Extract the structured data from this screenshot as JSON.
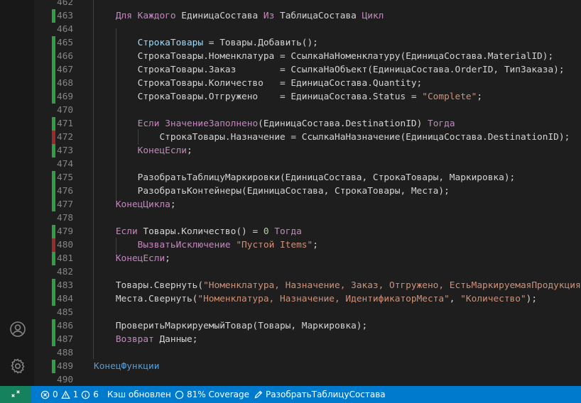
{
  "editor": {
    "lines": [
      {
        "n": "462",
        "g": "",
        "t": []
      },
      {
        "n": "463",
        "g": "add",
        "t": [
          [
            "    ",
            "plain"
          ],
          [
            "Для Каждого",
            "kw"
          ],
          [
            " ЕдиницаСостава ",
            "plain"
          ],
          [
            "Из",
            "kw"
          ],
          [
            " ТаблицаСостава ",
            "plain"
          ],
          [
            "Цикл",
            "kw"
          ]
        ]
      },
      {
        "n": "464",
        "g": "",
        "t": []
      },
      {
        "n": "465",
        "g": "add",
        "t": [
          [
            "        ",
            "plain"
          ],
          [
            "СтрокаТовары",
            "var"
          ],
          [
            " = Товары.Добавить();",
            "plain"
          ]
        ]
      },
      {
        "n": "466",
        "g": "add",
        "t": [
          [
            "        СтрокаТовары.Номенклатура = СсылкаНаНоменклатуру(ЕдиницаСостава.MaterialID);",
            "plain"
          ]
        ]
      },
      {
        "n": "467",
        "g": "add",
        "t": [
          [
            "        СтрокаТовары.Заказ        = СсылкаНаОбъект(ЕдиницаСостава.OrderID, ТипЗаказа);",
            "plain"
          ]
        ]
      },
      {
        "n": "468",
        "g": "add",
        "t": [
          [
            "        СтрокаТовары.Количество   = ЕдиницаСостава.Quantity;",
            "plain"
          ]
        ]
      },
      {
        "n": "469",
        "g": "add",
        "t": [
          [
            "        СтрокаТовары.Отгружено    = ЕдиницаСостава.Status = ",
            "plain"
          ],
          [
            "\"Complete\"",
            "str"
          ],
          [
            ";",
            "plain"
          ]
        ]
      },
      {
        "n": "470",
        "g": "",
        "t": []
      },
      {
        "n": "471",
        "g": "add",
        "t": [
          [
            "        ",
            "plain"
          ],
          [
            "Если",
            "kw"
          ],
          [
            " ",
            "plain"
          ],
          [
            "ЗначениеЗаполнено",
            "fn"
          ],
          [
            "(ЕдиницаСостава.DestinationID) ",
            "plain"
          ],
          [
            "Тогда",
            "kw"
          ]
        ]
      },
      {
        "n": "472",
        "g": "del",
        "t": [
          [
            "            СтрокаТовары.Назначение = СсылкаНаНазначение(ЕдиницаСостава.DestinationID);",
            "plain"
          ]
        ]
      },
      {
        "n": "473",
        "g": "add",
        "t": [
          [
            "        ",
            "plain"
          ],
          [
            "КонецЕсли",
            "kw"
          ],
          [
            ";",
            "plain"
          ]
        ]
      },
      {
        "n": "474",
        "g": "",
        "t": []
      },
      {
        "n": "475",
        "g": "add",
        "t": [
          [
            "        РазобратьТаблицуМаркировки(ЕдиницаСостава, СтрокаТовары, Маркировка);",
            "plain"
          ]
        ]
      },
      {
        "n": "476",
        "g": "add",
        "t": [
          [
            "        РазобратьКонтейнеры(ЕдиницаСостава, СтрокаТовары, Места);",
            "plain"
          ]
        ]
      },
      {
        "n": "477",
        "g": "add",
        "t": [
          [
            "    ",
            "plain"
          ],
          [
            "КонецЦикла",
            "kw"
          ],
          [
            ";",
            "plain"
          ]
        ]
      },
      {
        "n": "478",
        "g": "",
        "t": []
      },
      {
        "n": "479",
        "g": "add",
        "t": [
          [
            "    ",
            "plain"
          ],
          [
            "Если",
            "kw"
          ],
          [
            " Товары.Количество() = ",
            "plain"
          ],
          [
            "0",
            "num"
          ],
          [
            " ",
            "plain"
          ],
          [
            "Тогда",
            "kw"
          ]
        ]
      },
      {
        "n": "480",
        "g": "del",
        "t": [
          [
            "        ",
            "plain"
          ],
          [
            "ВызватьИсключение",
            "kw"
          ],
          [
            " ",
            "plain"
          ],
          [
            "\"Пустой Items\"",
            "str"
          ],
          [
            ";",
            "plain"
          ]
        ]
      },
      {
        "n": "481",
        "g": "add",
        "t": [
          [
            "    ",
            "plain"
          ],
          [
            "КонецЕсли",
            "kw"
          ],
          [
            ";",
            "plain"
          ]
        ]
      },
      {
        "n": "482",
        "g": "",
        "t": []
      },
      {
        "n": "483",
        "g": "add",
        "t": [
          [
            "    Товары.Свернуть(",
            "plain"
          ],
          [
            "\"Номенклатура, Назначение, Заказ, Отгружено, ЕстьМаркируемаяПродукция\"",
            "str"
          ]
        ]
      },
      {
        "n": "484",
        "g": "add",
        "t": [
          [
            "    Места.Свернуть(",
            "plain"
          ],
          [
            "\"Номенклатура, Назначение, ИдентификаторМеста\"",
            "str"
          ],
          [
            ", ",
            "plain"
          ],
          [
            "\"Количество\"",
            "str"
          ],
          [
            ");",
            "plain"
          ]
        ]
      },
      {
        "n": "485",
        "g": "",
        "t": []
      },
      {
        "n": "486",
        "g": "add",
        "t": [
          [
            "    ПроверитьМаркируемыйТовар(Товары, Маркировка);",
            "plain"
          ]
        ]
      },
      {
        "n": "487",
        "g": "add",
        "t": [
          [
            "    ",
            "plain"
          ],
          [
            "Возврат",
            "kw"
          ],
          [
            " Данные;",
            "plain"
          ]
        ]
      },
      {
        "n": "488",
        "g": "",
        "t": []
      },
      {
        "n": "489",
        "g": "add",
        "t": [
          [
            "",
            "plain"
          ],
          [
            "КонецФункции",
            "kwblue"
          ]
        ]
      },
      {
        "n": "490",
        "g": "",
        "t": []
      }
    ]
  },
  "statusbar": {
    "errors": "0",
    "warnings": "1",
    "info": "6",
    "cache": "Кэш обновлен",
    "coverage": "81% Coverage",
    "symbol": "РазобратьТаблицуСостава"
  },
  "colors": {
    "status_bg": "#007acc",
    "remote_bg": "#16825d",
    "git_added": "#2ea043",
    "git_deleted": "#9a2b2b",
    "keyword": "#c586c0",
    "string": "#ce9178",
    "number": "#b5cea8"
  },
  "icons": {
    "activity": [
      "account-icon",
      "settings-gear-icon"
    ],
    "status": [
      "remote-icon",
      "error-icon",
      "warning-icon",
      "info-icon",
      "coverage-icon",
      "edit-icon"
    ]
  }
}
